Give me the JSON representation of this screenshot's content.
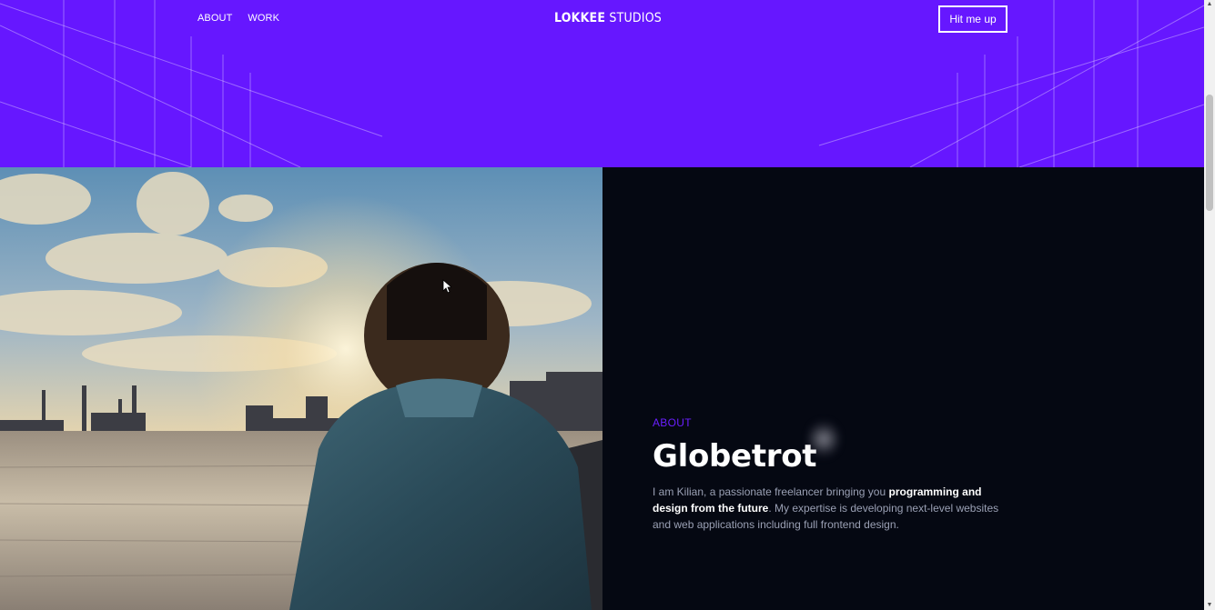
{
  "nav": {
    "links": [
      "ABOUT",
      "WORK"
    ],
    "brand_bold": "LOKKEE",
    "brand_light": "STUDIOS",
    "cta_label": "Hit me up"
  },
  "about": {
    "eyebrow": "ABOUT",
    "title": "Globetrot",
    "body_start": "I am Kilian, a passionate freelancer bringing you ",
    "body_bold": "programming and design from the future",
    "body_end": ". My expertise is developing next-level websites and web applications including full frontend design."
  },
  "colors": {
    "accent": "#6617ff",
    "background": "#050812",
    "eyebrow": "#6a1fff",
    "body_text": "#9aa0b4"
  },
  "icons": {
    "scroll_up": "triangle-up",
    "scroll_down": "triangle-down",
    "cursor": "mouse-pointer"
  }
}
